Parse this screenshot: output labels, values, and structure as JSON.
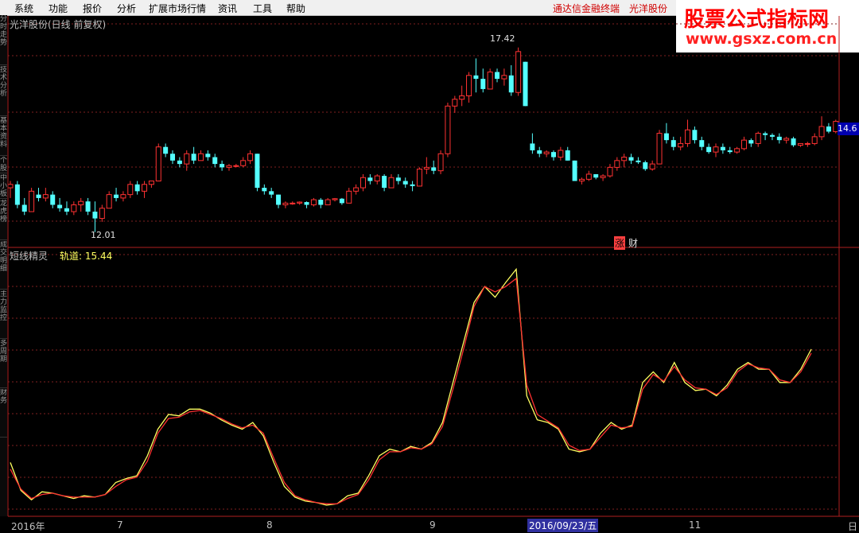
{
  "menu": [
    "系统",
    "功能",
    "报价",
    "分析",
    "扩展市场行情",
    "资讯",
    "工具",
    "帮助"
  ],
  "menu_right": [
    "通达信金融终端",
    "光洋股份"
  ],
  "watermark": {
    "title": "股票公式指标网",
    "url": "www.gsxz.com.cn"
  },
  "side_tabs": [
    "分时走势",
    "技术分析",
    "基本资料",
    "个股",
    "中小板",
    "龙虎榜",
    "成交明细",
    "主力监控",
    "多周期",
    "财务"
  ],
  "upper": {
    "title": "光洋股份(日线 前复权)",
    "high_label": "17.42",
    "low_label": "12.01",
    "price_tag": "14.6",
    "tag_zhang": "涨",
    "tag_cai": "财"
  },
  "lower": {
    "title": "短线精灵",
    "value": "轨道: 15.44"
  },
  "x_axis": {
    "labels": [
      "2016年",
      "7",
      "8",
      "9",
      "11"
    ],
    "selected": "2016/09/23/五",
    "day": "日"
  },
  "colors": {
    "up": "#ff3232",
    "down": "#54ffff",
    "grid": "#802020",
    "fast": "#ffff60",
    "slow": "#ff3030"
  },
  "chart_data": {
    "type": "candlestick",
    "candles": [
      [
        13.3,
        13.5,
        13.0,
        13.4
      ],
      [
        13.4,
        13.5,
        12.7,
        12.8
      ],
      [
        12.8,
        13.0,
        12.5,
        12.6
      ],
      [
        12.6,
        13.3,
        12.6,
        13.2
      ],
      [
        13.1,
        13.3,
        12.9,
        13.0
      ],
      [
        13.0,
        13.3,
        12.9,
        13.1
      ],
      [
        13.1,
        13.2,
        12.7,
        12.8
      ],
      [
        12.8,
        13.0,
        12.6,
        12.7
      ],
      [
        12.7,
        12.9,
        12.5,
        12.6
      ],
      [
        12.6,
        12.9,
        12.5,
        12.8
      ],
      [
        12.8,
        13.0,
        12.6,
        12.9
      ],
      [
        12.9,
        13.0,
        12.5,
        12.6
      ],
      [
        12.6,
        12.9,
        12.0,
        12.4
      ],
      [
        12.4,
        12.8,
        12.3,
        12.7
      ],
      [
        12.7,
        13.2,
        12.7,
        13.1
      ],
      [
        13.1,
        13.3,
        12.9,
        13.0
      ],
      [
        13.0,
        13.2,
        12.9,
        13.1
      ],
      [
        13.1,
        13.5,
        13.0,
        13.4
      ],
      [
        13.4,
        13.5,
        13.1,
        13.2
      ],
      [
        13.2,
        13.5,
        13.0,
        13.4
      ],
      [
        13.4,
        13.5,
        13.3,
        13.5
      ],
      [
        13.5,
        14.6,
        13.5,
        14.5
      ],
      [
        14.5,
        14.6,
        14.2,
        14.3
      ],
      [
        14.3,
        14.4,
        14.0,
        14.1
      ],
      [
        14.1,
        14.2,
        13.9,
        14.0
      ],
      [
        14.0,
        14.4,
        13.8,
        14.3
      ],
      [
        14.3,
        14.5,
        14.0,
        14.1
      ],
      [
        14.1,
        14.4,
        14.1,
        14.3
      ],
      [
        14.3,
        14.4,
        14.1,
        14.2
      ],
      [
        14.2,
        14.3,
        13.9,
        14.0
      ],
      [
        14.0,
        14.1,
        13.8,
        13.9
      ],
      [
        13.9,
        14.0,
        13.8,
        13.95
      ],
      [
        13.95,
        14.0,
        13.9,
        13.95
      ],
      [
        13.95,
        14.2,
        13.9,
        14.1
      ],
      [
        14.1,
        14.4,
        14.0,
        14.3
      ],
      [
        14.3,
        14.3,
        13.2,
        13.3
      ],
      [
        13.3,
        13.4,
        13.1,
        13.2
      ],
      [
        13.2,
        13.3,
        13.0,
        13.1
      ],
      [
        13.1,
        13.1,
        12.7,
        12.8
      ],
      [
        12.8,
        12.9,
        12.7,
        12.85
      ],
      [
        12.85,
        12.9,
        12.8,
        12.85
      ],
      [
        12.85,
        12.9,
        12.8,
        12.88
      ],
      [
        12.88,
        12.9,
        12.7,
        12.8
      ],
      [
        12.8,
        13.0,
        12.75,
        12.95
      ],
      [
        12.95,
        13.0,
        12.7,
        12.8
      ],
      [
        12.8,
        13.0,
        12.8,
        12.95
      ],
      [
        12.95,
        13.0,
        12.9,
        12.98
      ],
      [
        12.98,
        13.0,
        12.8,
        12.85
      ],
      [
        12.85,
        13.3,
        12.85,
        13.2
      ],
      [
        13.2,
        13.4,
        13.1,
        13.3
      ],
      [
        13.3,
        13.7,
        13.2,
        13.6
      ],
      [
        13.6,
        13.7,
        13.4,
        13.5
      ],
      [
        13.5,
        13.7,
        13.4,
        13.65
      ],
      [
        13.65,
        13.7,
        13.2,
        13.3
      ],
      [
        13.3,
        13.7,
        13.3,
        13.6
      ],
      [
        13.6,
        13.7,
        13.4,
        13.5
      ],
      [
        13.5,
        13.6,
        13.3,
        13.4
      ],
      [
        13.4,
        13.5,
        13.2,
        13.35
      ],
      [
        13.35,
        13.9,
        13.35,
        13.85
      ],
      [
        13.85,
        14.2,
        13.7,
        13.9
      ],
      [
        13.9,
        14.1,
        13.7,
        13.8
      ],
      [
        13.8,
        14.4,
        13.7,
        14.3
      ],
      [
        14.3,
        15.8,
        14.2,
        15.7
      ],
      [
        15.7,
        16.0,
        15.5,
        15.9
      ],
      [
        15.9,
        16.3,
        15.7,
        16.0
      ],
      [
        16.0,
        16.7,
        15.8,
        16.6
      ],
      [
        16.6,
        17.1,
        16.1,
        16.5
      ],
      [
        16.5,
        16.8,
        16.1,
        16.2
      ],
      [
        16.2,
        16.8,
        16.2,
        16.7
      ],
      [
        16.7,
        16.8,
        16.4,
        16.5
      ],
      [
        16.5,
        16.8,
        16.3,
        16.6
      ],
      [
        16.6,
        16.9,
        16.0,
        16.1
      ],
      [
        16.1,
        17.42,
        16.0,
        17.3
      ],
      [
        17.0,
        17.0,
        15.7,
        15.7
      ],
      [
        14.6,
        14.9,
        14.3,
        14.4
      ],
      [
        14.4,
        14.5,
        14.2,
        14.3
      ],
      [
        14.3,
        14.4,
        14.2,
        14.35
      ],
      [
        14.35,
        14.4,
        14.1,
        14.2
      ],
      [
        14.2,
        14.5,
        14.1,
        14.4
      ],
      [
        14.4,
        14.5,
        14.1,
        14.1
      ],
      [
        14.1,
        14.1,
        13.5,
        13.5
      ],
      [
        13.5,
        13.6,
        13.4,
        13.55
      ],
      [
        13.55,
        13.8,
        13.5,
        13.7
      ],
      [
        13.7,
        13.7,
        13.55,
        13.6
      ],
      [
        13.6,
        13.7,
        13.5,
        13.65
      ],
      [
        13.65,
        14.0,
        13.6,
        13.9
      ],
      [
        13.9,
        14.2,
        13.8,
        14.1
      ],
      [
        14.1,
        14.3,
        13.9,
        14.2
      ],
      [
        14.2,
        14.3,
        14.0,
        14.1
      ],
      [
        14.1,
        14.2,
        14.0,
        14.05
      ],
      [
        14.05,
        14.1,
        13.8,
        13.85
      ],
      [
        13.85,
        14.1,
        13.8,
        14.0
      ],
      [
        14.0,
        15.0,
        14.0,
        14.9
      ],
      [
        14.9,
        15.2,
        14.6,
        14.7
      ],
      [
        14.7,
        14.8,
        14.4,
        14.5
      ],
      [
        14.5,
        14.8,
        14.4,
        14.6
      ],
      [
        14.6,
        15.3,
        14.5,
        15.0
      ],
      [
        15.0,
        15.1,
        14.6,
        14.7
      ],
      [
        14.7,
        14.8,
        14.4,
        14.5
      ],
      [
        14.5,
        14.6,
        14.3,
        14.35
      ],
      [
        14.35,
        14.6,
        14.2,
        14.5
      ],
      [
        14.5,
        14.6,
        14.3,
        14.4
      ],
      [
        14.4,
        14.5,
        14.3,
        14.35
      ],
      [
        14.35,
        14.5,
        14.3,
        14.45
      ],
      [
        14.45,
        14.8,
        14.4,
        14.7
      ],
      [
        14.7,
        14.75,
        14.5,
        14.6
      ],
      [
        14.6,
        14.95,
        14.5,
        14.9
      ],
      [
        14.9,
        14.95,
        14.7,
        14.85
      ],
      [
        14.85,
        14.9,
        14.7,
        14.8
      ],
      [
        14.8,
        14.9,
        14.6,
        14.7
      ],
      [
        14.7,
        14.8,
        14.6,
        14.75
      ],
      [
        14.75,
        14.8,
        14.5,
        14.55
      ],
      [
        14.55,
        14.6,
        14.5,
        14.6
      ],
      [
        14.6,
        14.65,
        14.5,
        14.6
      ],
      [
        14.6,
        14.9,
        14.55,
        14.8
      ],
      [
        14.8,
        15.4,
        14.7,
        15.1
      ],
      [
        15.1,
        15.2,
        14.9,
        14.95
      ],
      [
        14.95,
        15.3,
        14.9,
        15.25
      ]
    ],
    "fast_line": [
      1.3,
      1.09,
      1.02,
      1.08,
      1.07,
      1.05,
      1.03,
      1.05,
      1.04,
      1.06,
      1.15,
      1.18,
      1.2,
      1.35,
      1.55,
      1.66,
      1.65,
      1.7,
      1.7,
      1.67,
      1.62,
      1.58,
      1.55,
      1.6,
      1.5,
      1.3,
      1.12,
      1.04,
      1.01,
      1.0,
      0.98,
      0.99,
      1.05,
      1.07,
      1.2,
      1.35,
      1.4,
      1.38,
      1.42,
      1.4,
      1.45,
      1.6,
      1.9,
      2.2,
      2.5,
      2.62,
      2.54,
      2.65,
      2.75,
      1.8,
      1.62,
      1.6,
      1.55,
      1.4,
      1.38,
      1.4,
      1.52,
      1.6,
      1.55,
      1.58,
      1.9,
      1.98,
      1.9,
      2.05,
      1.9,
      1.84,
      1.85,
      1.8,
      1.88,
      2.0,
      2.05,
      2.0,
      2.0,
      1.9,
      1.9,
      2.0,
      2.15
    ],
    "slow_line": [
      1.25,
      1.1,
      1.03,
      1.06,
      1.07,
      1.05,
      1.04,
      1.04,
      1.04,
      1.06,
      1.12,
      1.17,
      1.19,
      1.31,
      1.52,
      1.63,
      1.64,
      1.68,
      1.69,
      1.66,
      1.63,
      1.59,
      1.56,
      1.58,
      1.52,
      1.33,
      1.15,
      1.05,
      1.02,
      1.0,
      0.99,
      0.99,
      1.03,
      1.06,
      1.17,
      1.32,
      1.38,
      1.38,
      1.41,
      1.4,
      1.44,
      1.57,
      1.85,
      2.15,
      2.47,
      2.62,
      2.58,
      2.62,
      2.68,
      1.88,
      1.66,
      1.61,
      1.56,
      1.43,
      1.39,
      1.4,
      1.49,
      1.58,
      1.56,
      1.57,
      1.85,
      1.96,
      1.91,
      2.02,
      1.92,
      1.86,
      1.85,
      1.81,
      1.86,
      1.98,
      2.04,
      2.01,
      2.0,
      1.92,
      1.9,
      1.98,
      2.12
    ]
  }
}
